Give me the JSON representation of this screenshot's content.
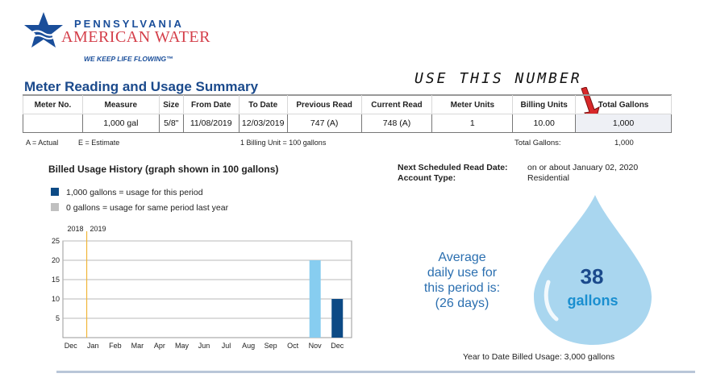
{
  "logo": {
    "line1": "PENNSYLVANIA",
    "line2": "AMERICAN WATER",
    "tagline": "WE KEEP LIFE FLOWING™",
    "colors": {
      "blue": "#1a4e9a",
      "red": "#d43f4a"
    },
    "icon": "star-water-logo-icon"
  },
  "annotation": {
    "text": "USE THIS NUMBER",
    "icon": "red-arrow-icon",
    "color": "#d8282a"
  },
  "summary": {
    "title": "Meter Reading and Usage Summary",
    "columns": [
      "Meter No.",
      "Measure",
      "Size",
      "From Date",
      "To Date",
      "Previous Read",
      "Current Read",
      "Meter Units",
      "Billing Units",
      "Total Gallons"
    ],
    "row": [
      "",
      "1,000 gal",
      "5/8\"",
      "11/08/2019",
      "12/03/2019",
      "747 (A)",
      "748 (A)",
      "1",
      "10.00",
      "1,000"
    ],
    "code_actual": "A = Actual",
    "code_estimate": "E = Estimate",
    "billing_unit_note": "1 Billing Unit = 100 gallons",
    "total_label": "Total Gallons:",
    "total_value": "1,000"
  },
  "history": {
    "title": "Billed Usage History (graph shown in 100 gallons)",
    "legend_current": "1,000 gallons = usage for this period",
    "legend_last_year": "0 gallons = usage for same period last year",
    "colors": {
      "current": "#0d4a85",
      "last_year": "#87cdf0",
      "legend_gray": "#c0c0c0",
      "year_line": "#f0b63a"
    }
  },
  "chart_data": {
    "type": "bar",
    "categories": [
      "Dec",
      "Jan",
      "Feb",
      "Mar",
      "Apr",
      "May",
      "Jun",
      "Jul",
      "Aug",
      "Sep",
      "Oct",
      "Nov",
      "Dec"
    ],
    "year_labels": [
      "2018",
      "2019"
    ],
    "series": [
      {
        "name": "same period last year",
        "values": [
          0,
          0,
          0,
          0,
          0,
          0,
          0,
          0,
          0,
          0,
          0,
          20,
          0
        ]
      },
      {
        "name": "this period",
        "values": [
          0,
          0,
          0,
          0,
          0,
          0,
          0,
          0,
          0,
          0,
          0,
          0,
          10
        ]
      }
    ],
    "yticks": [
      5,
      10,
      15,
      20,
      25
    ],
    "ylim": [
      0,
      25
    ],
    "grid": true,
    "legend": "top-left"
  },
  "account": {
    "next_read_label": "Next Scheduled Read Date:",
    "next_read_value": "on or about January 02, 2020",
    "account_type_label": "Account Type:",
    "account_type_value": "Residential"
  },
  "average": {
    "line1": "Average",
    "line2": "daily use for",
    "line3": "this period is:",
    "line4": "(26 days)",
    "value": "38",
    "unit": "gallons",
    "drop_color": "#a9d6ef"
  },
  "ytd": "Year to Date Billed Usage: 3,000 gallons"
}
